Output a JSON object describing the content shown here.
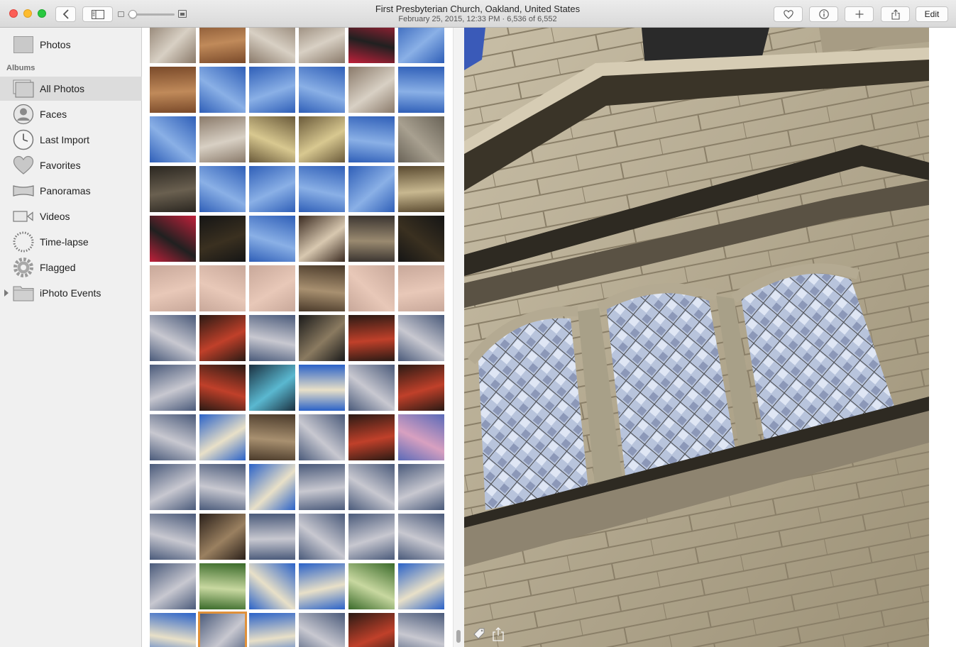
{
  "window": {
    "title": "First Presbyterian Church, Oakland, United States",
    "subtitle": "February 25, 2015, 12:33 PM  ·  6,536 of 6,552"
  },
  "toolbar": {
    "edit_label": "Edit"
  },
  "sidebar": {
    "top_item": {
      "label": "Photos",
      "icon": "photos-icon"
    },
    "section_label": "Albums",
    "items": [
      {
        "label": "All Photos",
        "icon": "all-photos-icon",
        "selected": true
      },
      {
        "label": "Faces",
        "icon": "faces-icon"
      },
      {
        "label": "Last Import",
        "icon": "clock-icon"
      },
      {
        "label": "Favorites",
        "icon": "heart-icon"
      },
      {
        "label": "Panoramas",
        "icon": "panorama-icon"
      },
      {
        "label": "Videos",
        "icon": "video-camera-icon"
      },
      {
        "label": "Time-lapse",
        "icon": "time-lapse-icon"
      },
      {
        "label": "Flagged",
        "icon": "gear-icon"
      },
      {
        "label": "iPhoto Events",
        "icon": "folder-icon"
      }
    ]
  },
  "grid": {
    "columns": 6,
    "rows": 13,
    "selected_index": 73,
    "tiles": [
      "cat",
      "wood",
      "cat",
      "cat",
      "redcat",
      "sky",
      "wood",
      "sky",
      "sky",
      "sky",
      "cat",
      "sky",
      "sky",
      "cat",
      "interior",
      "interior",
      "sky",
      "stairs",
      "dark",
      "sky",
      "sky",
      "sky",
      "sky",
      "plaque",
      "redcat",
      "night",
      "sky",
      "board",
      "poster",
      "night",
      "hand",
      "hand",
      "hand",
      "catface",
      "hand",
      "hand",
      "church",
      "stage",
      "church",
      "door",
      "stage",
      "church",
      "church",
      "stage",
      "screen",
      "spire",
      "church",
      "stage",
      "church",
      "spire",
      "catface",
      "church",
      "stage",
      "blossom",
      "church",
      "church",
      "spire",
      "church",
      "church",
      "church",
      "church",
      "glove",
      "church",
      "church",
      "church",
      "church",
      "church",
      "tree",
      "spire",
      "spire",
      "tree",
      "spire",
      "spire",
      "church",
      "spire",
      "church",
      "stage",
      "church"
    ],
    "palette": {
      "sky": [
        "#2f5fb8",
        "#8ab0e6"
      ],
      "cat": [
        "#8a7a6a",
        "#d8d0c4"
      ],
      "redcat": [
        "#c0203a",
        "#202020"
      ],
      "wood": [
        "#7a4a2a",
        "#c08a5a"
      ],
      "interior": [
        "#6a5a3a",
        "#d8c890"
      ],
      "stairs": [
        "#6a6458",
        "#a8a090"
      ],
      "dark": [
        "#2a2620",
        "#6a6050"
      ],
      "plaque": [
        "#5a4a30",
        "#c8b890"
      ],
      "night": [
        "#151515",
        "#3a3020"
      ],
      "board": [
        "#3a2a20",
        "#d8c8b0"
      ],
      "poster": [
        "#3a3430",
        "#9a8a70"
      ],
      "hand": [
        "#c8a89a",
        "#e8c8b8"
      ],
      "catface": [
        "#4a3a2a",
        "#a89070"
      ],
      "church": [
        "#4a5a7a",
        "#c8c8d0"
      ],
      "stage": [
        "#2a1a14",
        "#c0402a"
      ],
      "door": [
        "#1a1a1a",
        "#8a7a60"
      ],
      "screen": [
        "#1a3040",
        "#5ab8d0"
      ],
      "spire": [
        "#2a62c8",
        "#e8e0c8"
      ],
      "blossom": [
        "#5a6ab8",
        "#d8a0c0"
      ],
      "glove": [
        "#2a201a",
        "#9a8060"
      ],
      "tree": [
        "#3a6a2a",
        "#c8d8a0"
      ]
    }
  },
  "colors": {
    "accent_selected": "#e0913a",
    "sidebar_bg": "#f0f0f0",
    "sidebar_selected": "#dcdcdc"
  }
}
